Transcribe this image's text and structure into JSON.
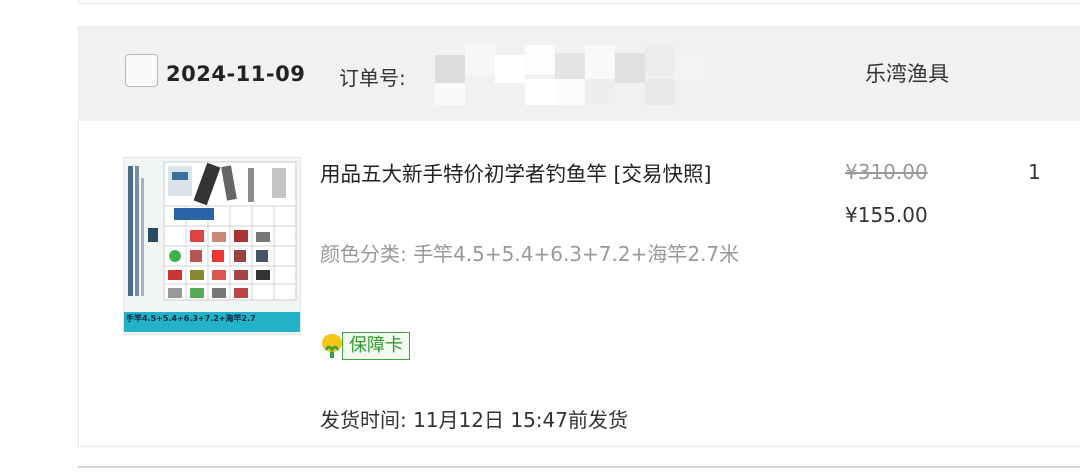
{
  "order": {
    "date": "2024-11-09",
    "order_no_label": "订单号: ",
    "shop_name": "乐湾渔具"
  },
  "item": {
    "title": "用品五大新手特价初学者钓鱼竿 [交易快照]",
    "spec": "颜色分类: 手竿4.5+5.4+6.3+7.2+海竿2.7米",
    "guarantee_label": "保障卡",
    "ship_time": "发货时间: 11月12日 15:47前发货",
    "original_price": "¥310.00",
    "current_price": "¥155.00",
    "quantity": "1",
    "thumb_caption": "手竿4.5+5.4+6.3+7.2+海竿2.7"
  },
  "colors": {
    "header_bg": "#f1f1f1",
    "guarantee_green": "#41a441",
    "thumb_banner": "#22b3c8"
  },
  "icons": {
    "checkbox": "checkbox-icon",
    "guarantee": "shield-leaf-icon"
  }
}
